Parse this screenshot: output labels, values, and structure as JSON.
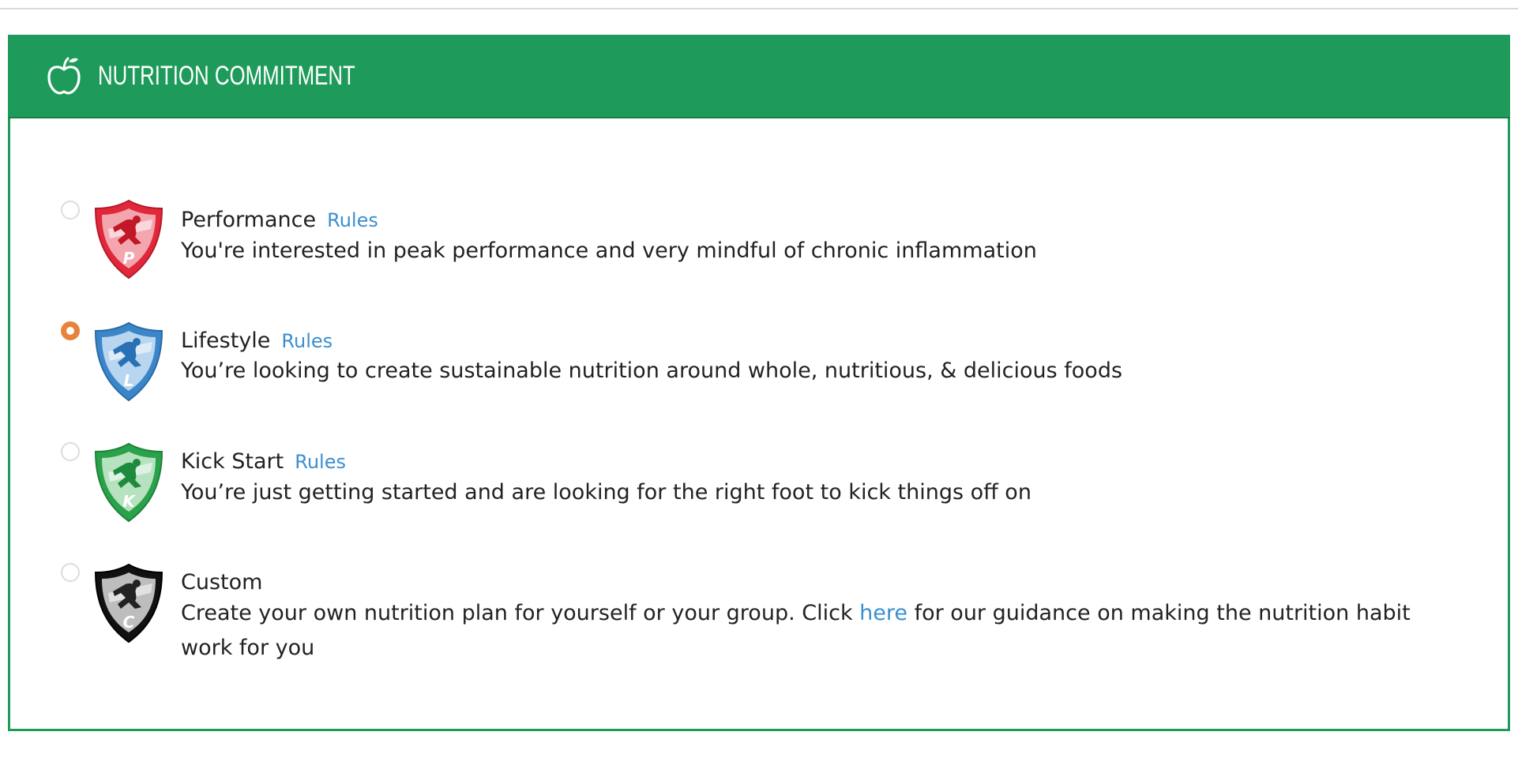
{
  "header": {
    "title": "NUTRITION COMMITMENT",
    "icon": "apple-icon",
    "color": "#1e9b5a"
  },
  "options": [
    {
      "title": "Performance",
      "rules_label": "Rules",
      "description": "You're interested in peak performance and very mindful of chronic inflammation",
      "badge_letter": "P",
      "badge_color": "#e0283a",
      "selected": false
    },
    {
      "title": "Lifestyle",
      "rules_label": "Rules",
      "description": "You’re looking to create sustainable nutrition around whole, nutritious, & delicious foods",
      "badge_letter": "L",
      "badge_color": "#3a86c8",
      "selected": true
    },
    {
      "title": "Kick Start",
      "rules_label": "Rules",
      "description": "You’re just getting started and are looking for the right foot to kick things off on",
      "badge_letter": "K",
      "badge_color": "#2aa24a",
      "selected": false
    },
    {
      "title": "Custom",
      "description_before": "Create your own nutrition plan for yourself or your group. Click ",
      "link_text": "here",
      "description_after": " for our guidance on making the nutrition habit work for you",
      "badge_letter": "C",
      "badge_color": "#111111",
      "selected": false
    }
  ],
  "colors": {
    "link": "#3b8fd0",
    "radio_selected": "#e8833a"
  }
}
